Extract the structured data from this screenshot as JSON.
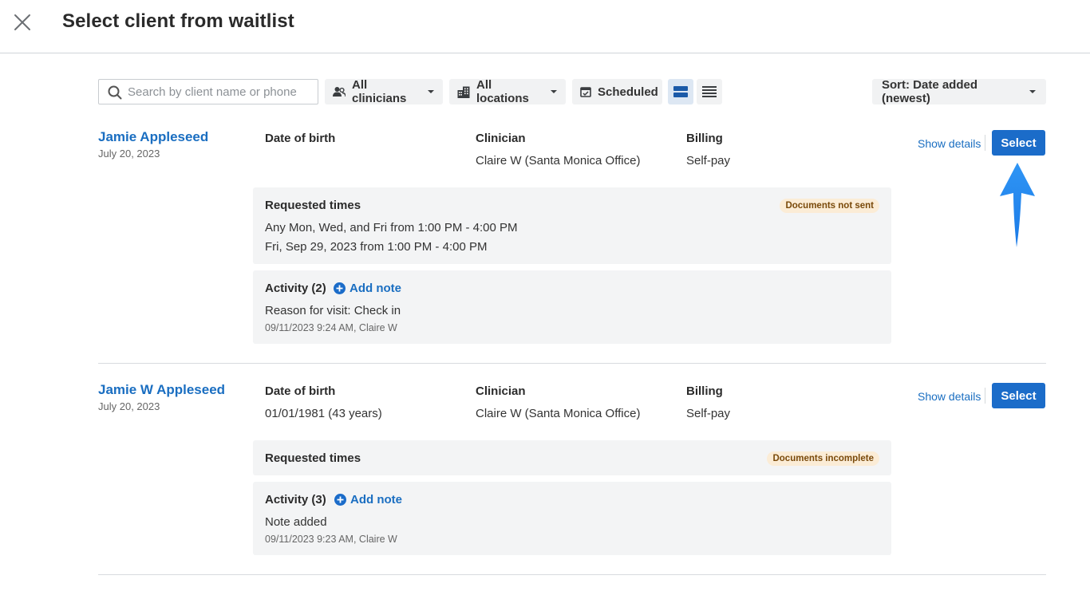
{
  "header": {
    "title": "Select client from waitlist",
    "close_icon": "close-icon"
  },
  "toolbar": {
    "search_placeholder": "Search by client name or phone",
    "clinicians_label": "All clinicians",
    "locations_label": "All locations",
    "scheduled_label": "Scheduled",
    "sort_label": "Sort: Date added (newest)"
  },
  "labels": {
    "dob": "Date of birth",
    "clinician": "Clinician",
    "billing": "Billing",
    "requested_times": "Requested times",
    "show_details": "Show details",
    "select": "Select",
    "add_note": "Add note"
  },
  "clients": [
    {
      "name": "Jamie Appleseed",
      "added": "July 20, 2023",
      "dob": "",
      "clinician": "Claire W (Santa Monica Office)",
      "billing": "Self-pay",
      "badge": "Documents not sent",
      "times": [
        "Any Mon, Wed, and Fri from 1:00 PM - 4:00 PM",
        "Fri, Sep 29, 2023 from 1:00 PM - 4:00 PM"
      ],
      "activity_title": "Activity (2)",
      "activity_text": "Reason for visit: Check in",
      "activity_meta": "09/11/2023 9:24 AM, Claire W"
    },
    {
      "name": "Jamie W Appleseed",
      "added": "July 20, 2023",
      "dob": "01/01/1981 (43 years)",
      "clinician": "Claire W (Santa Monica Office)",
      "billing": "Self-pay",
      "badge": "Documents incomplete",
      "times": [],
      "activity_title": "Activity (3)",
      "activity_text": "Note added",
      "activity_meta": "09/11/2023 9:23 AM, Claire W"
    }
  ],
  "colors": {
    "accent": "#1b6cc9",
    "link": "#1a6ec1",
    "badge_bg": "#fbecd6",
    "badge_text": "#7a4a0b",
    "arrow": "#2a8cf0"
  }
}
